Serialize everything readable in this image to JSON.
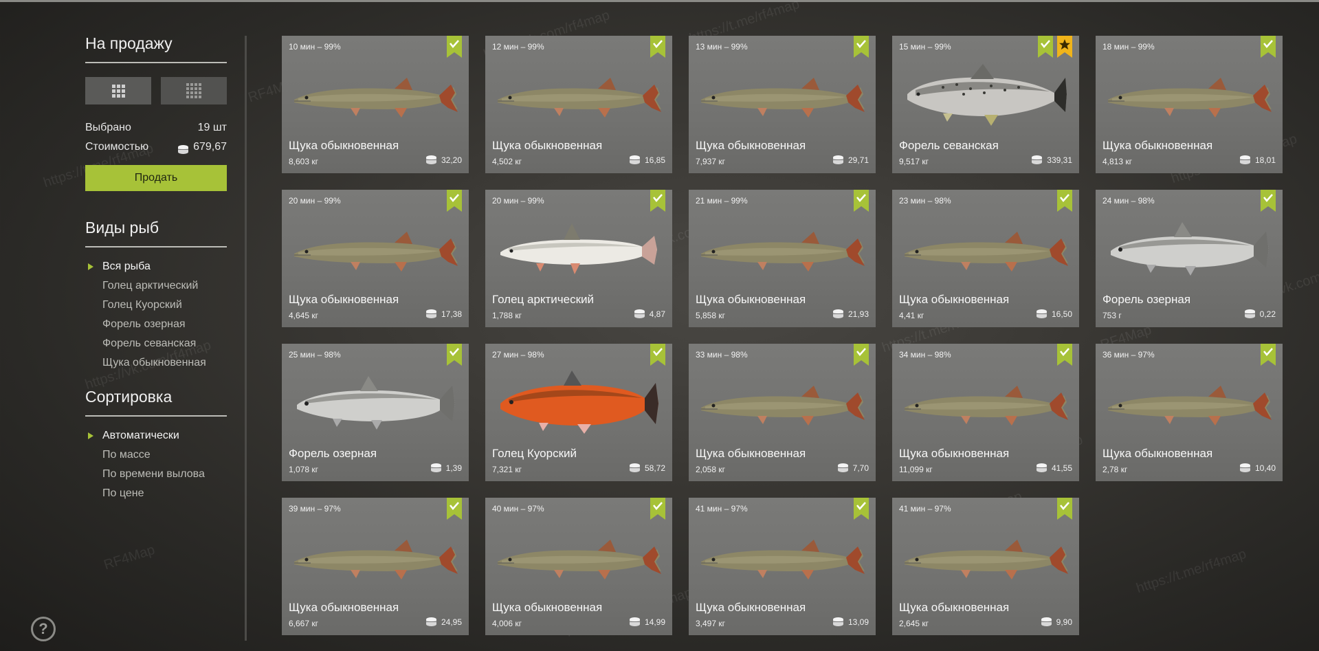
{
  "sidebar": {
    "sale_title": "На продажу",
    "selected_label": "Выбрано",
    "selected_value": "19 шт",
    "cost_label": "Стоимостью",
    "cost_value": "679,67",
    "sell_button": "Продать",
    "species_title": "Виды рыб",
    "species": [
      {
        "label": "Вся рыба",
        "active": true
      },
      {
        "label": "Голец арктический",
        "active": false
      },
      {
        "label": "Голец Куорский",
        "active": false
      },
      {
        "label": "Форель озерная",
        "active": false
      },
      {
        "label": "Форель севанская",
        "active": false
      },
      {
        "label": "Щука обыкновенная",
        "active": false
      }
    ],
    "sort_title": "Сортировка",
    "sorts": [
      {
        "label": "Автоматически",
        "active": true
      },
      {
        "label": "По массе",
        "active": false
      },
      {
        "label": "По времени вылова",
        "active": false
      },
      {
        "label": "По цене",
        "active": false
      }
    ]
  },
  "help_icon": "?",
  "colors": {
    "accent": "#a7c238",
    "star": "#f0b41a"
  },
  "watermarks": [
    "RF4Map",
    "https://vk.com/rf4map",
    "https://t.me/rf4map"
  ],
  "cards": [
    {
      "time": "10 мин – 99%",
      "name": "Щука обыкновенная",
      "weight": "8,603 кг",
      "price": "32,20",
      "fish": "pike",
      "star": false
    },
    {
      "time": "12 мин – 99%",
      "name": "Щука обыкновенная",
      "weight": "4,502 кг",
      "price": "16,85",
      "fish": "pike",
      "star": false
    },
    {
      "time": "13 мин – 99%",
      "name": "Щука обыкновенная",
      "weight": "7,937 кг",
      "price": "29,71",
      "fish": "pike",
      "star": false
    },
    {
      "time": "15 мин – 99%",
      "name": "Форель севанская",
      "weight": "9,517 кг",
      "price": "339,31",
      "fish": "sevan-trout",
      "star": true
    },
    {
      "time": "18 мин – 99%",
      "name": "Щука обыкновенная",
      "weight": "4,813 кг",
      "price": "18,01",
      "fish": "pike",
      "star": false
    },
    {
      "time": "20 мин – 99%",
      "name": "Щука обыкновенная",
      "weight": "4,645 кг",
      "price": "17,38",
      "fish": "pike",
      "star": false
    },
    {
      "time": "20 мин – 99%",
      "name": "Голец арктический",
      "weight": "1,788 кг",
      "price": "4,87",
      "fish": "arctic-char",
      "star": false
    },
    {
      "time": "21 мин – 99%",
      "name": "Щука обыкновенная",
      "weight": "5,858 кг",
      "price": "21,93",
      "fish": "pike",
      "star": false
    },
    {
      "time": "23 мин – 98%",
      "name": "Щука обыкновенная",
      "weight": "4,41 кг",
      "price": "16,50",
      "fish": "pike",
      "star": false
    },
    {
      "time": "24 мин – 98%",
      "name": "Форель озерная",
      "weight": "753 г",
      "price": "0,22",
      "fish": "lake-trout",
      "star": false
    },
    {
      "time": "25 мин – 98%",
      "name": "Форель озерная",
      "weight": "1,078 кг",
      "price": "1,39",
      "fish": "lake-trout",
      "star": false
    },
    {
      "time": "27 мин – 98%",
      "name": "Голец Куорский",
      "weight": "7,321 кг",
      "price": "58,72",
      "fish": "kuori-char",
      "star": false
    },
    {
      "time": "33 мин – 98%",
      "name": "Щука обыкновенная",
      "weight": "2,058 кг",
      "price": "7,70",
      "fish": "pike",
      "star": false
    },
    {
      "time": "34 мин – 98%",
      "name": "Щука обыкновенная",
      "weight": "11,099 кг",
      "price": "41,55",
      "fish": "pike",
      "star": false
    },
    {
      "time": "36 мин – 97%",
      "name": "Щука обыкновенная",
      "weight": "2,78 кг",
      "price": "10,40",
      "fish": "pike",
      "star": false
    },
    {
      "time": "39 мин – 97%",
      "name": "Щука обыкновенная",
      "weight": "6,667 кг",
      "price": "24,95",
      "fish": "pike",
      "star": false
    },
    {
      "time": "40 мин – 97%",
      "name": "Щука обыкновенная",
      "weight": "4,006 кг",
      "price": "14,99",
      "fish": "pike",
      "star": false
    },
    {
      "time": "41 мин – 97%",
      "name": "Щука обыкновенная",
      "weight": "3,497 кг",
      "price": "13,09",
      "fish": "pike",
      "star": false
    },
    {
      "time": "41 мин – 97%",
      "name": "Щука обыкновенная",
      "weight": "2,645 кг",
      "price": "9,90",
      "fish": "pike",
      "star": false
    }
  ]
}
